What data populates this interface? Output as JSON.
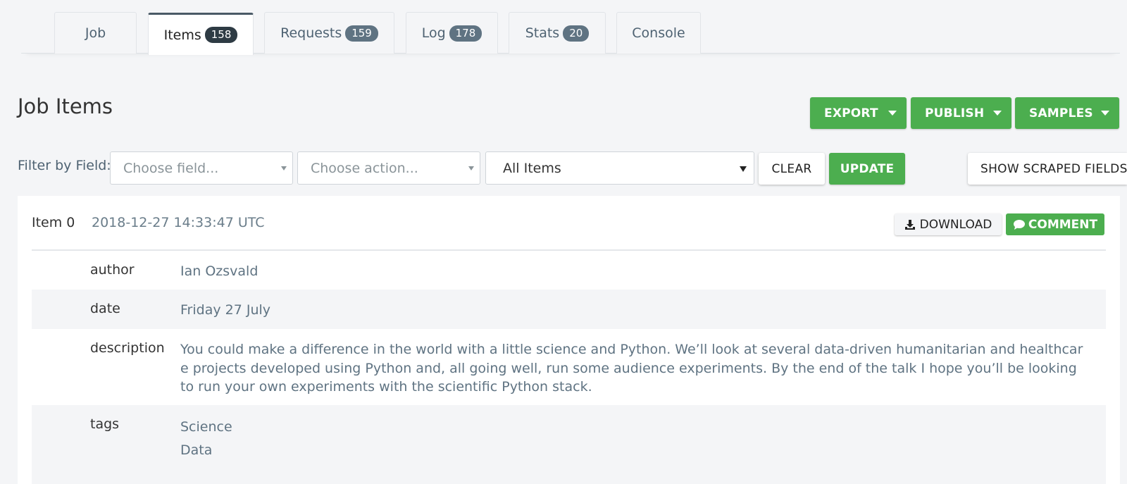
{
  "tabs": [
    {
      "label": "Job",
      "count": null
    },
    {
      "label": "Items",
      "count": "158"
    },
    {
      "label": "Requests",
      "count": "159"
    },
    {
      "label": "Log",
      "count": "178"
    },
    {
      "label": "Stats",
      "count": "20"
    },
    {
      "label": "Console",
      "count": null
    }
  ],
  "active_tab": "Items",
  "page": {
    "title": "Job Items"
  },
  "actions": {
    "export": "EXPORT",
    "publish": "PUBLISH",
    "samples": "SAMPLES"
  },
  "filter": {
    "label": "Filter by Field:",
    "field_placeholder": "Choose field...",
    "action_placeholder": "Choose action...",
    "scope_value": "All Items",
    "clear": "CLEAR",
    "update": "UPDATE",
    "show_scraped": "SHOW SCRAPED FIELDS"
  },
  "item": {
    "title": "Item 0",
    "timestamp": "2018-12-27 14:33:47 UTC",
    "download": "DOWNLOAD",
    "comment": "COMMENT",
    "fields": [
      {
        "key": "author",
        "value": "Ian Ozsvald"
      },
      {
        "key": "date",
        "value": "Friday 27 July"
      },
      {
        "key": "description",
        "value": "You could make a difference in the world with a little science and Python. We’ll look at several data-driven humanitarian and healthcare projects developed using Python and, all going well, run some audience experiments. By the end of the talk I hope you’ll be looking to run your own experiments with the scientific Python stack."
      },
      {
        "key": "tags",
        "values": [
          "Science",
          "Data"
        ]
      }
    ]
  },
  "colors": {
    "green": "#4cae4f",
    "badge": "#5f7382",
    "badge_active": "#2e3b44",
    "background": "#f4f5f7"
  },
  "icons": {
    "download": "download-icon",
    "comment": "comment-icon",
    "dropdown": "caret-down-icon"
  }
}
